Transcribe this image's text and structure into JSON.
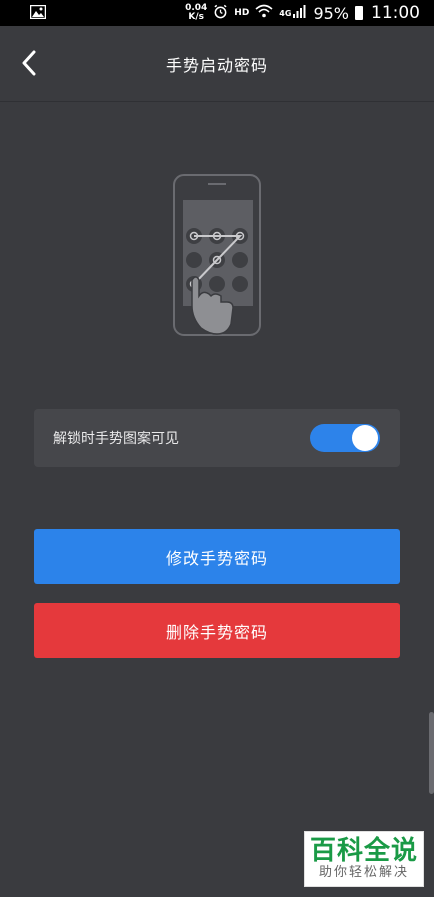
{
  "status_bar": {
    "net_speed_value": "0.04",
    "net_speed_unit": "K/s",
    "hd_label": "HD",
    "network_label": "4G",
    "battery_percent": "95%",
    "time": "11:00"
  },
  "header": {
    "title": "手势启动密码"
  },
  "settings": {
    "pattern_visible_label": "解锁时手势图案可见",
    "pattern_visible_enabled": true
  },
  "actions": {
    "modify_label": "修改手势密码",
    "delete_label": "删除手势密码"
  },
  "watermark": {
    "main": "百科全说",
    "sub": "助你轻松解决"
  },
  "colors": {
    "background": "#3a3b3f",
    "primary_blue": "#2c83ea",
    "danger_red": "#e5393c",
    "toggle_on": "#2d83ea",
    "watermark_green": "#1a9a46"
  }
}
